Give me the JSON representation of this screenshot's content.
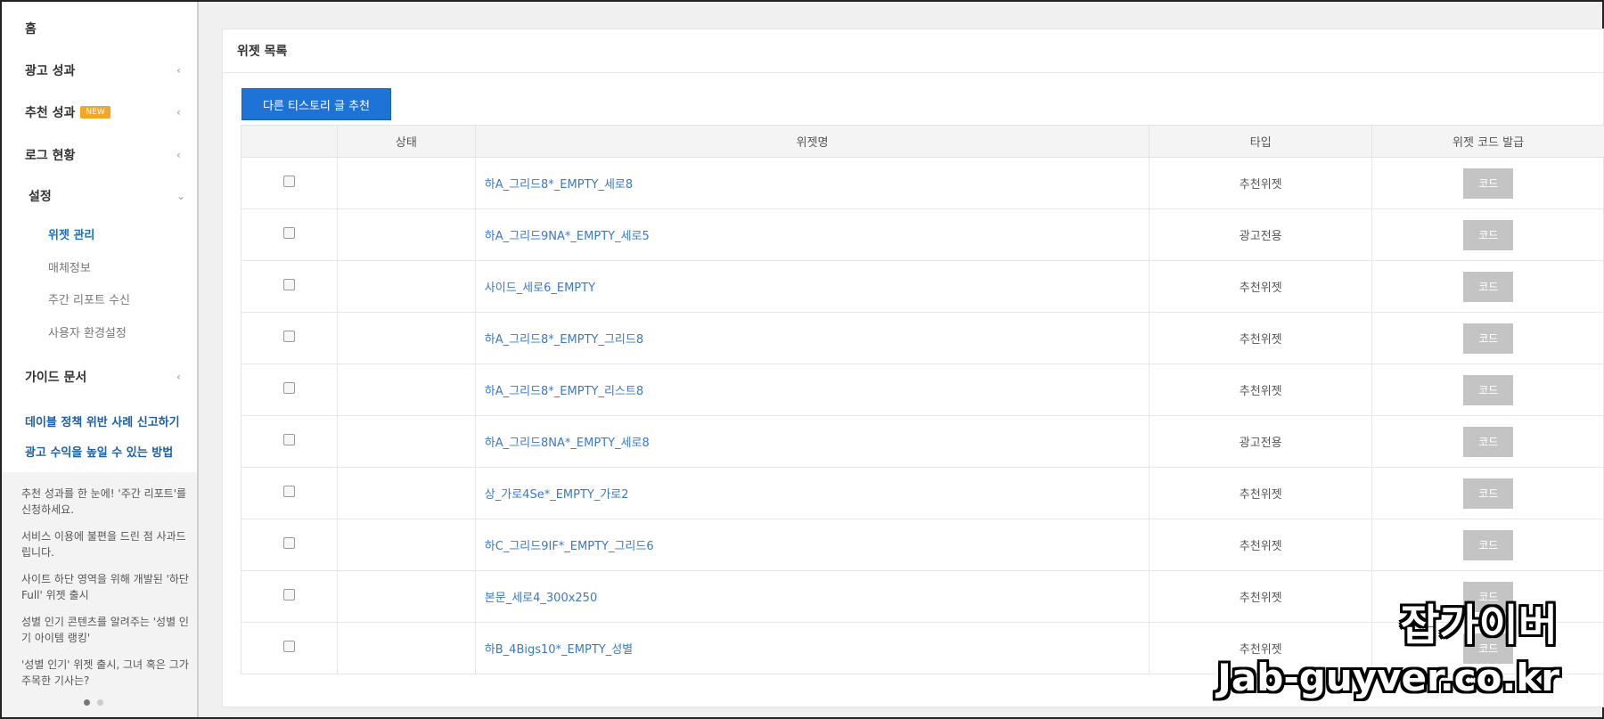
{
  "sidebar": {
    "home": "홈",
    "ad_performance": "광고 성과",
    "rec_performance": "추천 성과",
    "new_badge": "NEW",
    "log_status": "로그 현황",
    "settings": "설정",
    "sub_items": [
      "위젯 관리",
      "매체정보",
      "주간 리포트 수신",
      "사용자 환경설정"
    ],
    "guide_docs": "가이드 문서",
    "links": [
      "데이블 정책 위반 사례 신고하기",
      "광고 수익을 높일 수 있는 방법"
    ],
    "notices": [
      "추천 성과를 한 눈에! '주간 리포트'를 신청하세요.",
      "서비스 이용에 불편을 드린 점 사과드립니다.",
      "사이트 하단 영역을 위해 개발된 '하단 Full' 위젯 출시",
      "성별 인기 콘텐츠를 알려주는 '성별 인기 아이템 랭킹'",
      "'성별 인기' 위젯 출시, 그녀 혹은 그가 주목한 기사는?"
    ]
  },
  "main": {
    "title": "위젯 목록",
    "primary_button": "다른 티스토리 글 추천",
    "columns": [
      "",
      "상태",
      "위젯명",
      "타입",
      "위젯 코드 발급"
    ],
    "code_label": "코드",
    "rows": [
      {
        "name": "하A_그리드8*_EMPTY_세로8",
        "type": "추천위젯"
      },
      {
        "name": "하A_그리드9NA*_EMPTY_세로5",
        "type": "광고전용"
      },
      {
        "name": "사이드_세로6_EMPTY",
        "type": "추천위젯"
      },
      {
        "name": "하A_그리드8*_EMPTY_그리드8",
        "type": "추천위젯"
      },
      {
        "name": "하A_그리드8*_EMPTY_리스트8",
        "type": "추천위젯"
      },
      {
        "name": "하A_그리드8NA*_EMPTY_세로8",
        "type": "광고전용"
      },
      {
        "name": "상_가로4Se*_EMPTY_가로2",
        "type": "추천위젯"
      },
      {
        "name": "하C_그리드9IF*_EMPTY_그리드6",
        "type": "추천위젯"
      },
      {
        "name": "본문_세로4_300x250",
        "type": "추천위젯"
      },
      {
        "name": "하B_4Bigs10*_EMPTY_성별",
        "type": "추천위젯"
      }
    ]
  },
  "watermark": {
    "main": "잡가이버",
    "sub": "Jab-guyver.co.kr"
  },
  "colors": {
    "accent": "#1d73d6",
    "link": "#3a78c9",
    "badge": "#f5a623"
  }
}
